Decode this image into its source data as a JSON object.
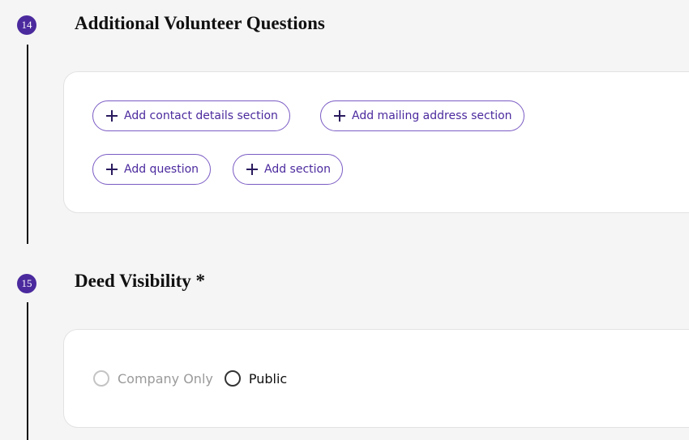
{
  "sections": [
    {
      "number": "14",
      "title": "Additional Volunteer Questions",
      "buttons": [
        "Add contact details section",
        "Add mailing address section",
        "Add question",
        "Add section"
      ]
    },
    {
      "number": "15",
      "title": "Deed Visibility *",
      "options": [
        {
          "label": "Company Only",
          "disabled": true
        },
        {
          "label": "Public",
          "disabled": false
        }
      ]
    }
  ],
  "colors": {
    "accent": "#4b2a9e",
    "pill_border": "#7b5cc4",
    "background": "#f5f5f5",
    "card": "#ffffff"
  },
  "icons": {
    "add": "plus-icon",
    "radio": "radio-icon"
  }
}
